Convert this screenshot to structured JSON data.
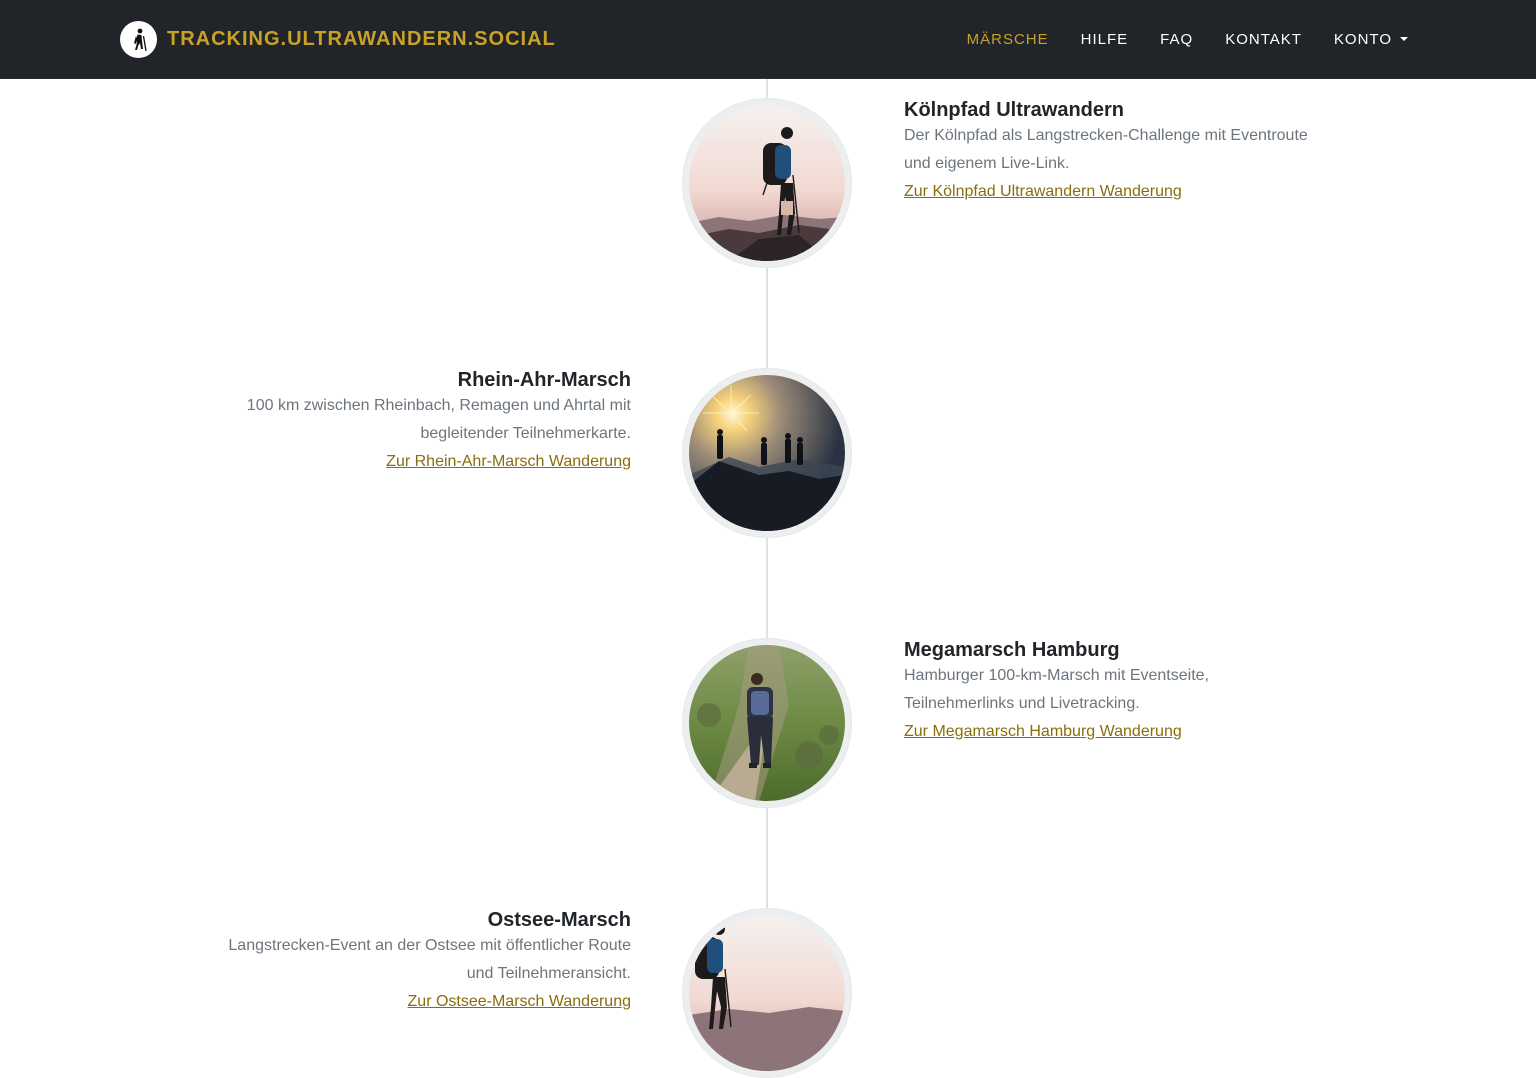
{
  "brand": {
    "name": "TRACKING.ULTRAWANDERN.SOCIAL",
    "logo_icon": "hiker-icon"
  },
  "nav": {
    "items": [
      {
        "label": "MÄRSCHE",
        "active": true
      },
      {
        "label": "HILFE",
        "active": false
      },
      {
        "label": "FAQ",
        "active": false
      },
      {
        "label": "KONTAKT",
        "active": false
      },
      {
        "label": "KONTO",
        "active": false,
        "dropdown": true
      }
    ]
  },
  "colors": {
    "accent": "#c9a227",
    "navbar": "#212529",
    "link": "#8a6d0b",
    "muted": "#6c757d"
  },
  "events": [
    {
      "title": "Kölnpfad Ultrawandern",
      "description_line1": "Der Kölnpfad als Langstrecken-Challenge mit Eventroute",
      "description_line2": "und eigenem Live-Link.",
      "link": "Zur Kölnpfad Ultrawandern Wanderung",
      "image": "hiker-sunset-photo"
    },
    {
      "title": "Rhein-Ahr-Marsch",
      "description_line1": "100 km zwischen Rheinbach, Remagen und Ahrtal mit",
      "description_line2": "begleitender Teilnehmerkarte.",
      "link": "Zur Rhein-Ahr-Marsch Wanderung",
      "image": "hikers-sunrise-photo"
    },
    {
      "title": "Megamarsch Hamburg",
      "description_line1": "Hamburger 100-km-Marsch mit Eventseite,",
      "description_line2": "Teilnehmerlinks und Livetracking.",
      "link": "Zur Megamarsch Hamburg Wanderung",
      "image": "hiker-trail-photo"
    },
    {
      "title": "Ostsee-Marsch",
      "description_line1": "Langstrecken-Event an der Ostsee mit öffentlicher Route",
      "description_line2": "und Teilnehmeransicht.",
      "link": "Zur Ostsee-Marsch Wanderung",
      "image": "hiker-sunset-photo"
    }
  ]
}
